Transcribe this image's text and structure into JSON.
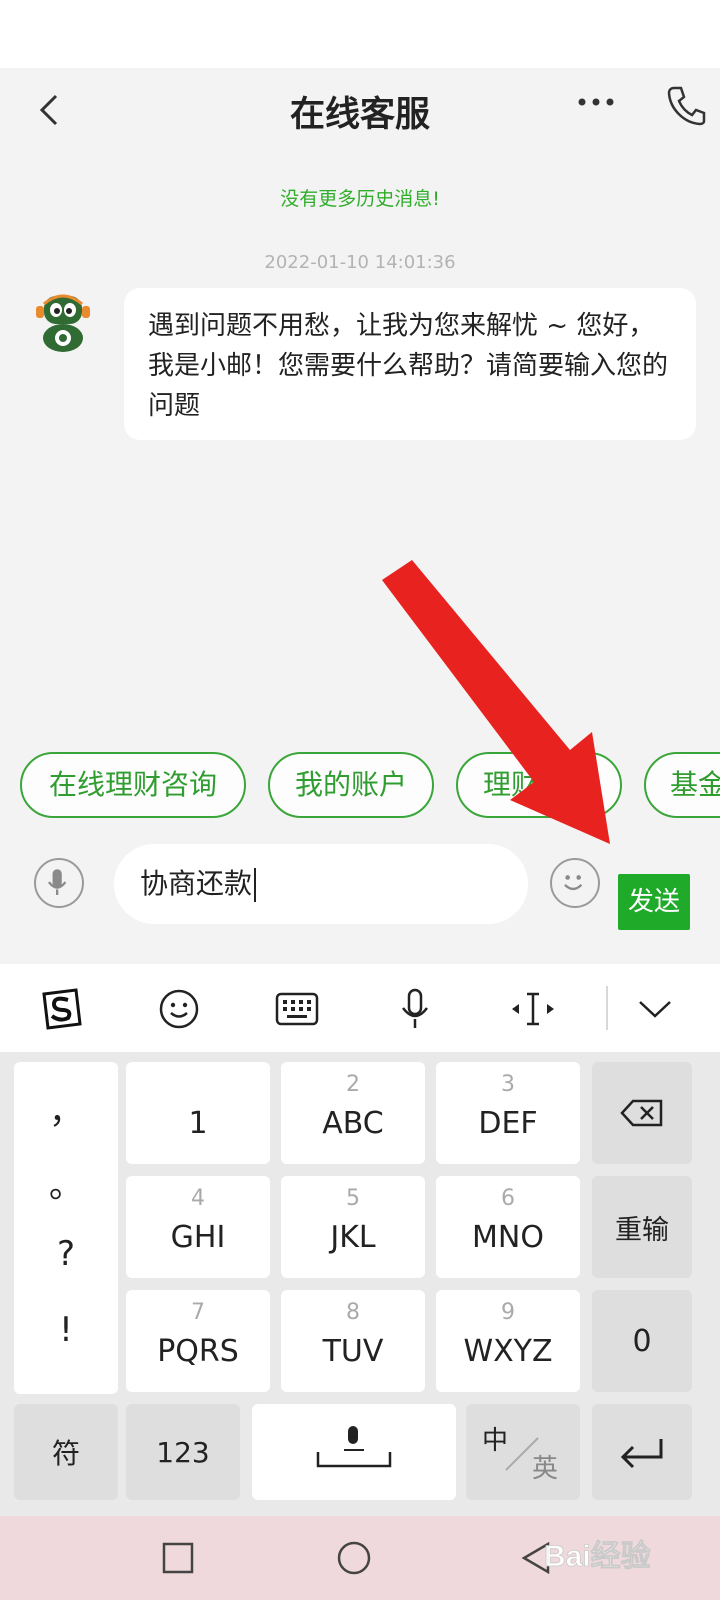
{
  "header": {
    "title": "在线客服"
  },
  "chat": {
    "no_history": "没有更多历史消息!",
    "timestamp": "2022-01-10 14:01:36",
    "bot_message": "遇到问题不用愁，让我为您来解忧 ~ 您好，我是小邮！您需要什么帮助？请简要输入您的问题"
  },
  "quick_replies": [
    "在线理财咨询",
    "我的账户",
    "理财服务",
    "基金"
  ],
  "input": {
    "value": "协商还款",
    "send_label": "发送"
  },
  "keyboard": {
    "punctuation": [
      "，",
      "。",
      "?",
      "!"
    ],
    "keys": [
      {
        "sub": "",
        "main": "1"
      },
      {
        "sub": "2",
        "main": "ABC"
      },
      {
        "sub": "3",
        "main": "DEF"
      },
      {
        "sub": "4",
        "main": "GHI"
      },
      {
        "sub": "5",
        "main": "JKL"
      },
      {
        "sub": "6",
        "main": "MNO"
      },
      {
        "sub": "7",
        "main": "PQRS"
      },
      {
        "sub": "8",
        "main": "TUV"
      },
      {
        "sub": "9",
        "main": "WXYZ"
      }
    ],
    "retype": "重输",
    "zero": "0",
    "symbols": "符",
    "numbers": "123",
    "lang_zh": "中",
    "lang_en": "英"
  },
  "watermark": "Bai经验",
  "colors": {
    "accent": "#1faa2a",
    "arrow": "#e8221f"
  }
}
